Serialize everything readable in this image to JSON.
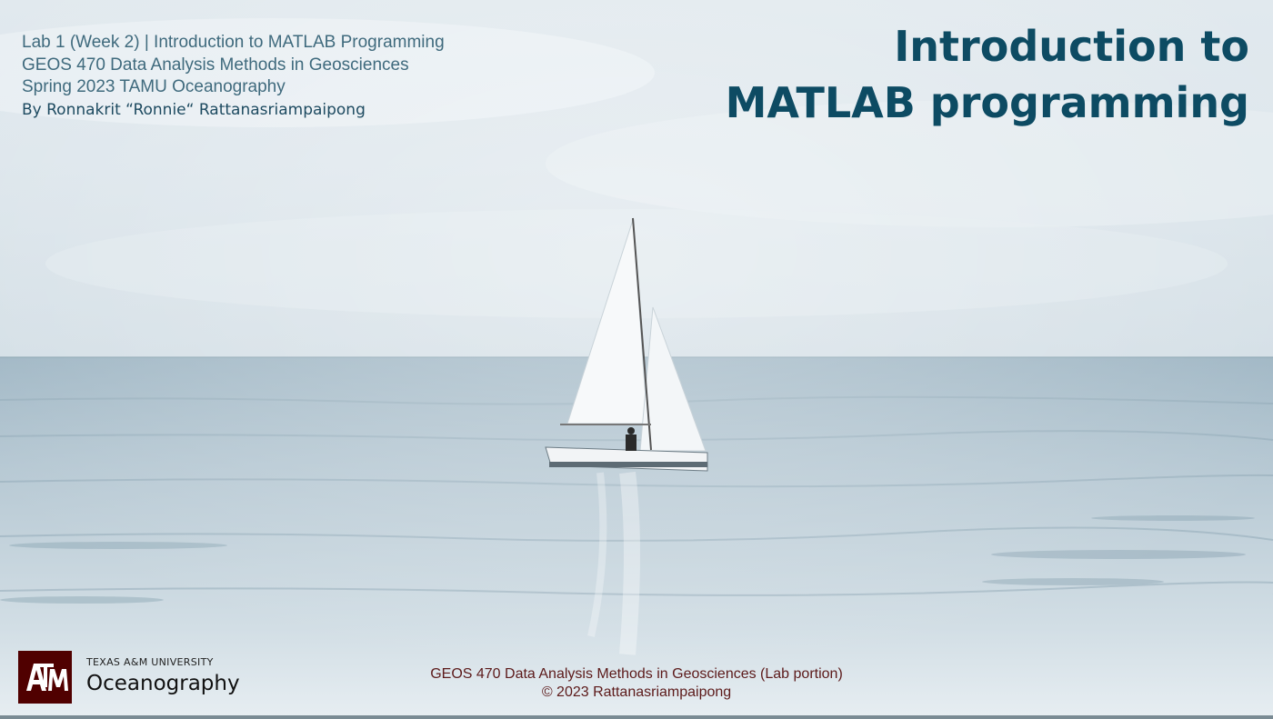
{
  "info": {
    "line1": "Lab 1 (Week 2) | Introduction to MATLAB Programming",
    "line2": "GEOS 470 Data Analysis Methods in Geosciences",
    "line3": "Spring 2023 TAMU Oceanography",
    "author": "By Ronnakrit “Ronnie“ Rattanasriampaipong"
  },
  "title": {
    "line1": "Introduction to",
    "line2": "MATLAB programming"
  },
  "logo": {
    "university": "TEXAS A&M UNIVERSITY",
    "department": "Oceanography",
    "color": "#500000"
  },
  "footer": {
    "course": "GEOS 470 Data Analysis Methods in Geosciences (Lab portion)",
    "copyright": "© 2023 Rattanasriampaipong"
  }
}
